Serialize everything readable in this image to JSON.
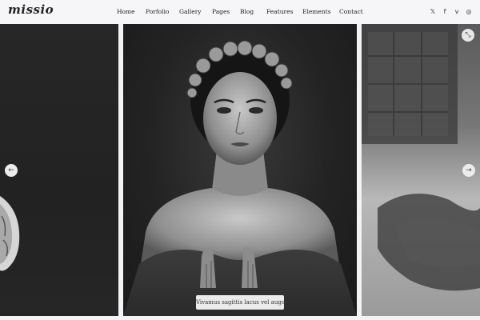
{
  "header": {
    "logo": "missio",
    "nav": [
      "Home",
      "Porfolio",
      "Gallery",
      "Pages",
      "Blog",
      "Features",
      "Elements",
      "Contact"
    ],
    "social_icons": [
      "twitter-icon",
      "facebook-icon",
      "vimeo-icon",
      "instagram-icon"
    ],
    "social_glyphs": [
      "𝕏",
      "f",
      "v",
      "◎"
    ]
  },
  "gallery": {
    "caption": "Vivamus sagittis lacus vel augue",
    "prev_glyph": "←",
    "next_glyph": "→",
    "expand_glyph": "⤡"
  }
}
